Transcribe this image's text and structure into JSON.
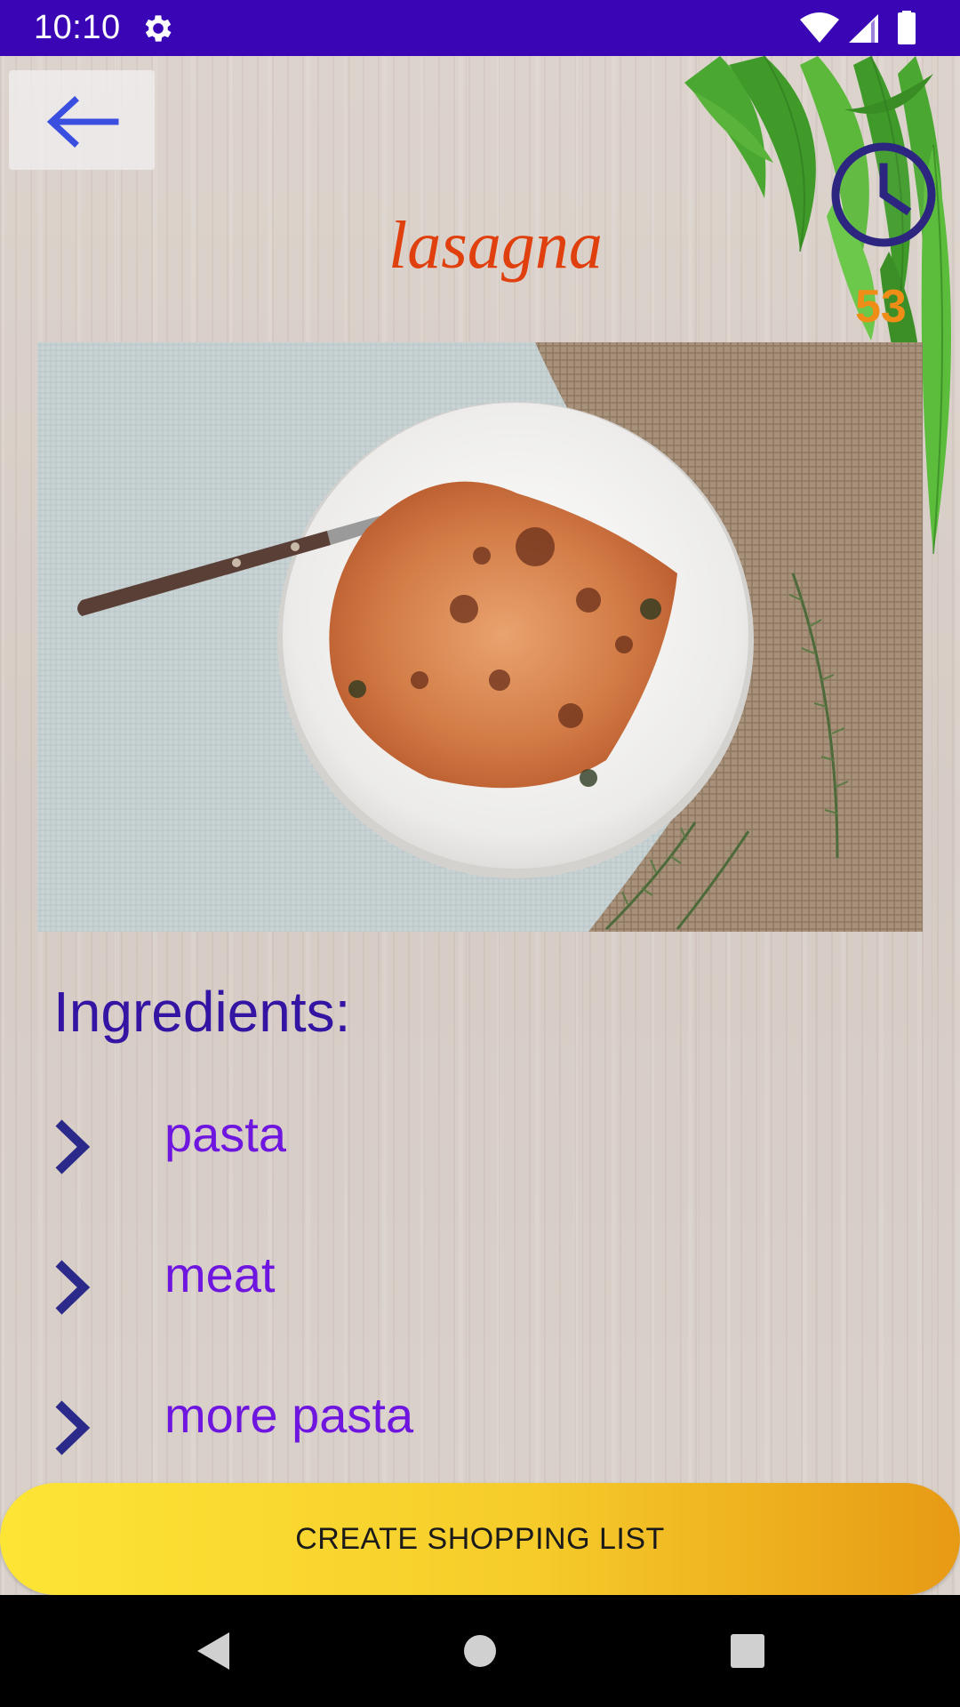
{
  "status_bar": {
    "time": "10:10",
    "icons": [
      "gear-icon",
      "wifi-icon",
      "cell-signal-icon",
      "battery-icon"
    ],
    "color": "#3a06b5"
  },
  "header": {
    "back_icon": "arrow-left-icon",
    "title": "lasagna",
    "title_color": "#e0400e",
    "clock_icon": "clock-icon",
    "cook_time": "53",
    "cook_time_color": "#ef8d17"
  },
  "photo": {
    "subject": "plate of lasagna with fork on linen cloth and rosemary"
  },
  "ingredients": {
    "heading": "Ingredients:",
    "items": [
      {
        "label": "pasta",
        "icon": "chevron-right-icon"
      },
      {
        "label": "meat",
        "icon": "chevron-right-icon"
      },
      {
        "label": "more pasta",
        "icon": "chevron-right-icon"
      }
    ]
  },
  "actions": {
    "shopping_list_label": "CREATE SHOPPING LIST"
  },
  "nav_bar": {
    "icons": [
      "nav-back-icon",
      "nav-home-icon",
      "nav-recents-icon"
    ]
  }
}
